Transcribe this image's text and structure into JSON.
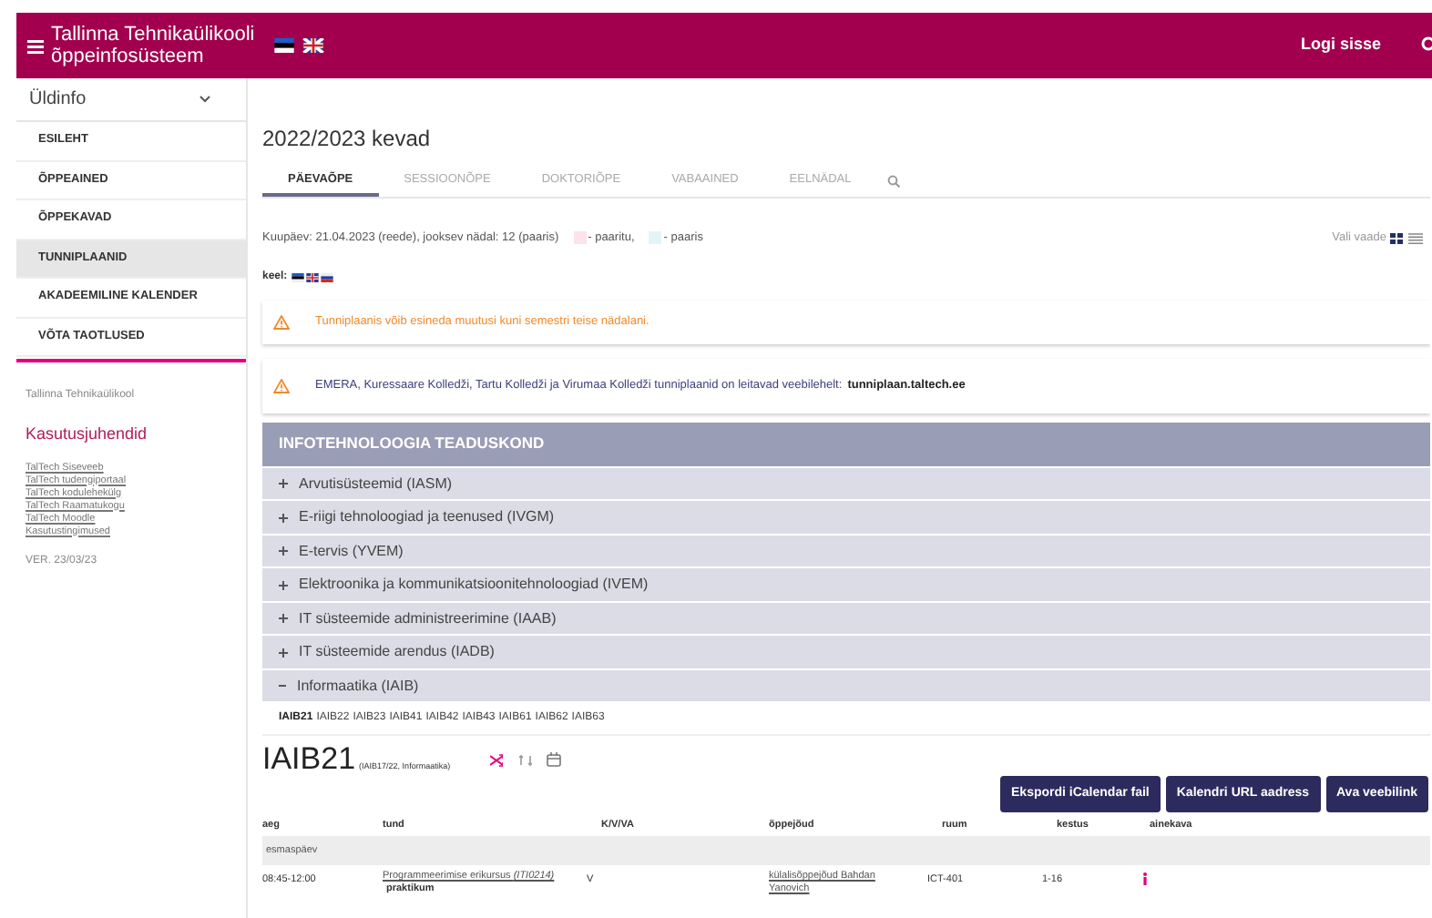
{
  "header": {
    "title": "Tallinna Tehnikaülikooli õppeinfosüsteem",
    "login": "Logi sisse"
  },
  "sidebar": {
    "section": "Üldinfo",
    "expanded": true,
    "items": [
      {
        "label": "ESILEHT",
        "selected": false
      },
      {
        "label": "ÕPPEAINED",
        "selected": false
      },
      {
        "label": "ÕPPEKAVAD",
        "selected": false
      },
      {
        "label": "TUNNIPLAANID",
        "selected": true
      },
      {
        "label": "AKADEEMILINE KALENDER",
        "selected": false
      },
      {
        "label": "VÕTA TAOTLUSED",
        "selected": false
      }
    ],
    "org": "Tallinna Tehnikaülikool",
    "guides_heading": "Kasutusjuhendid",
    "links": [
      "TalTech Siseveeb",
      "TalTech tudengiportaal",
      "TalTech kodulehekülg",
      "TalTech Raamatukogu",
      "TalTech Moodle",
      "Kasutustingimused"
    ],
    "version": "VER. 23/03/23"
  },
  "main": {
    "title": "2022/2023 kevad",
    "tabs": [
      {
        "label": "PÄEVAÕPE",
        "selected": true
      },
      {
        "label": "SESSIOONÕPE",
        "selected": false
      },
      {
        "label": "DOKTORIÕPE",
        "selected": false
      },
      {
        "label": "VABAAINED",
        "selected": false
      },
      {
        "label": "EELNÄDAL",
        "selected": false
      }
    ],
    "date_info": "Kuupäev: 21.04.2023 (reede), jooksev nädal: 12 (paaris)",
    "legend": [
      {
        "label": "- paaritu,",
        "color": "#fbe3ec"
      },
      {
        "label": "- paaris",
        "color": "#e3f4f8"
      }
    ],
    "view_label": "Vali vaade",
    "lang_label": "keel:",
    "alerts": [
      {
        "text": "Tunniplaanis võib esineda muutusi kuni semestri teise nädalani."
      },
      {
        "text": "EMERA, Kuressaare Kolledži, Tartu Kolledži ja Virumaa Kolledži tunniplaanid on leitavad veebilehelt:",
        "link": "tunniplaan.taltech.ee"
      }
    ],
    "faculty": "INFOTEHNOLOOGIA TEADUSKOND",
    "programs": [
      {
        "label": "Arvutisüsteemid (IASM)",
        "expanded": false
      },
      {
        "label": "E-riigi tehnoloogiad ja teenused (IVGM)",
        "expanded": false
      },
      {
        "label": "E-tervis (YVEM)",
        "expanded": false
      },
      {
        "label": "Elektroonika ja kommunikatsioonitehnoloogiad (IVEM)",
        "expanded": false
      },
      {
        "label": "IT süsteemide administreerimine (IAAB)",
        "expanded": false
      },
      {
        "label": "IT süsteemide arendus (IADB)",
        "expanded": false
      },
      {
        "label": "Informaatika (IAIB)",
        "expanded": true
      }
    ],
    "groups": [
      {
        "label": "IAIB21",
        "selected": true
      },
      {
        "label": "IAIB22",
        "selected": false
      },
      {
        "label": "IAIB23",
        "selected": false
      },
      {
        "label": "IAIB41",
        "selected": false
      },
      {
        "label": "IAIB42",
        "selected": false
      },
      {
        "label": "IAIB43",
        "selected": false
      },
      {
        "label": "IAIB61",
        "selected": false
      },
      {
        "label": "IAIB62",
        "selected": false
      },
      {
        "label": "IAIB63",
        "selected": false
      }
    ],
    "group_title": "IAIB21",
    "group_subtitle": "(IAIB17/22, Informaatika)",
    "buttons": [
      "Ekspordi iCalendar fail",
      "Kalendri URL aadress",
      "Ava veebilink"
    ],
    "table": {
      "columns": [
        "aeg",
        "tund",
        "K/V/VA",
        "õppejõud",
        "ruum",
        "kestus",
        "ainekava"
      ],
      "rows": [
        {
          "kind": "day",
          "label": "esmaspäev"
        },
        {
          "kind": "lesson",
          "time": "08:45-12:00",
          "course": "Programmeerimise erikursus *(ITI0214)*",
          "type": "praktikum",
          "kvva": "V",
          "teacher": "külalisõppejõud Bahdan Yanovich",
          "room": "ICT-401",
          "weeks": "1-16"
        }
      ]
    }
  }
}
